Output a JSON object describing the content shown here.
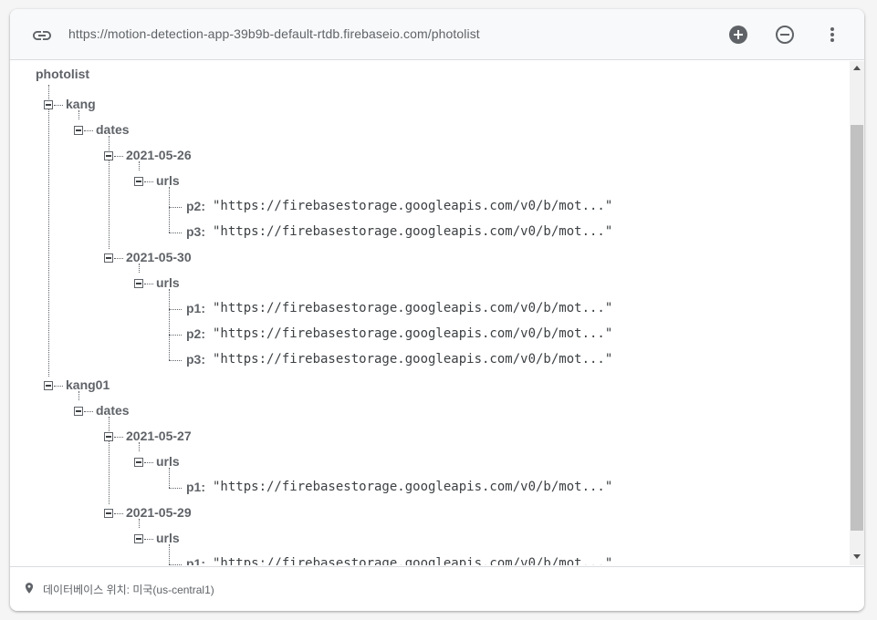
{
  "toolbar": {
    "url": "https://motion-detection-app-39b9b-default-rtdb.firebaseio.com/photolist",
    "icons": [
      "link-icon",
      "add-circle-icon",
      "remove-circle-icon",
      "more-vert-icon"
    ]
  },
  "tree": {
    "root": "photolist",
    "nodes": [
      {
        "key": "kang"
      },
      {
        "key": "dates"
      },
      {
        "key": "2021-05-26"
      },
      {
        "key": "urls"
      },
      {
        "key": "p2:",
        "value": "\"https://firebasestorage.googleapis.com/v0/b/mot...\""
      },
      {
        "key": "p3:",
        "value": "\"https://firebasestorage.googleapis.com/v0/b/mot...\""
      },
      {
        "key": "2021-05-30"
      },
      {
        "key": "urls"
      },
      {
        "key": "p1:",
        "value": "\"https://firebasestorage.googleapis.com/v0/b/mot...\""
      },
      {
        "key": "p2:",
        "value": "\"https://firebasestorage.googleapis.com/v0/b/mot...\""
      },
      {
        "key": "p3:",
        "value": "\"https://firebasestorage.googleapis.com/v0/b/mot...\""
      },
      {
        "key": "kang01"
      },
      {
        "key": "dates"
      },
      {
        "key": "2021-05-27"
      },
      {
        "key": "urls"
      },
      {
        "key": "p1:",
        "value": "\"https://firebasestorage.googleapis.com/v0/b/mot...\""
      },
      {
        "key": "2021-05-29"
      },
      {
        "key": "urls"
      },
      {
        "key": "p1:",
        "value": "\"https://firebasestorage.googleapis.com/v0/b/mot...\""
      }
    ]
  },
  "footer": {
    "location_text": "데이터베이스 위치: 미국(us-central1)"
  }
}
